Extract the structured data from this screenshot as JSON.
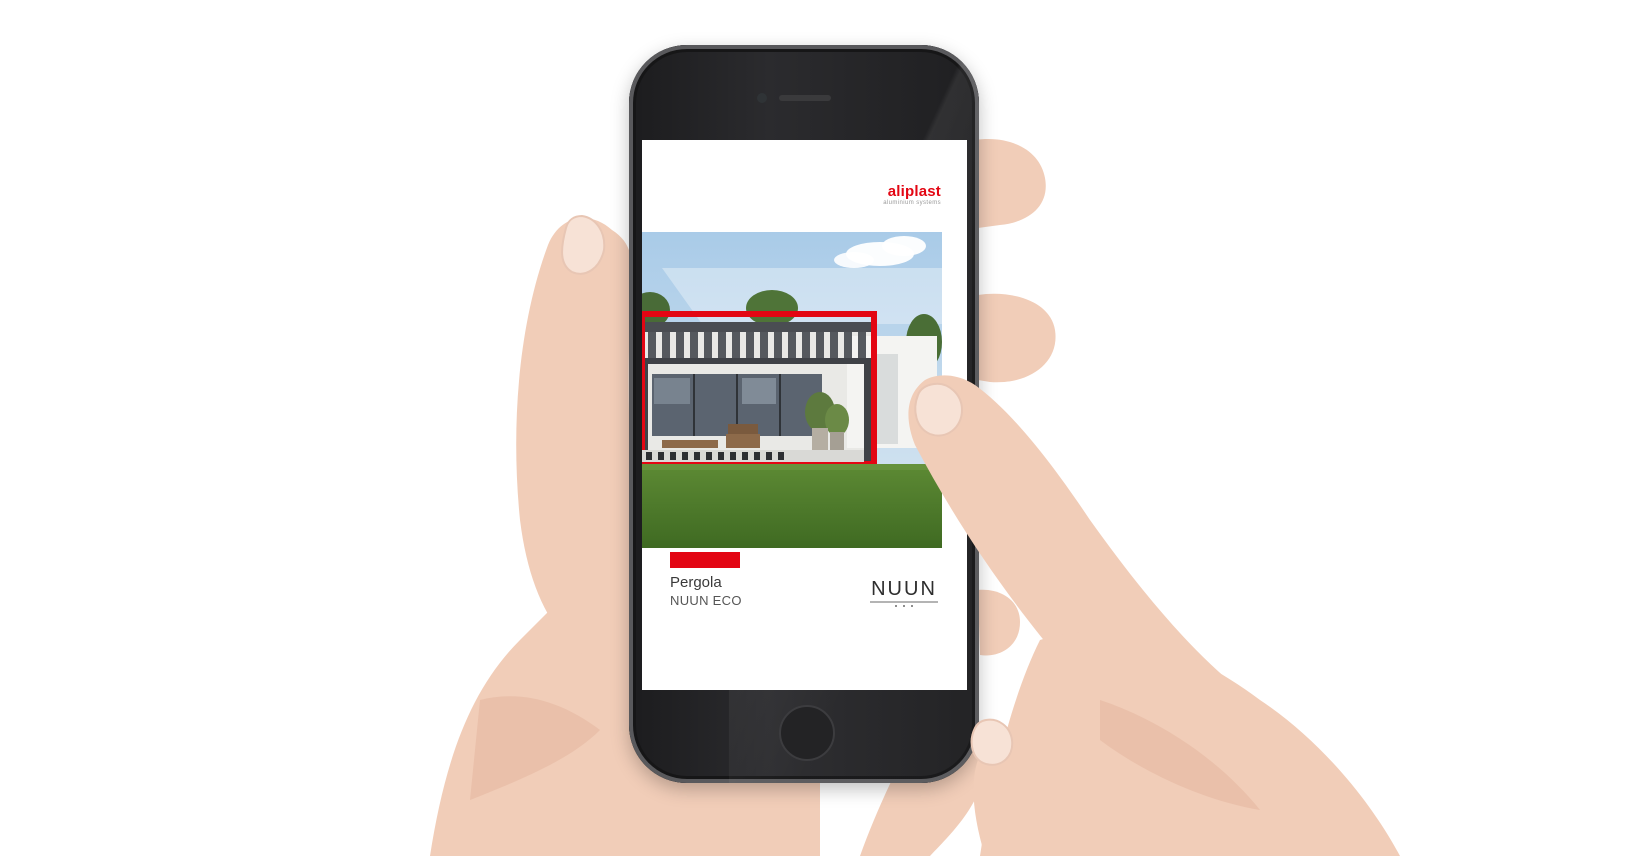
{
  "cover": {
    "brand_name": "aliplast",
    "brand_tagline": "aluminium systems",
    "product_title": "Pergola",
    "product_subtitle": "NUUN ECO",
    "logo_text": "NUUN"
  },
  "icons": {
    "nuun_logo": "nuun-logo-icon",
    "home_button": "home-button-icon"
  },
  "colors": {
    "brand_red": "#e30613",
    "phone_body": "#1f1f21",
    "grass": "#4f7a2c",
    "sky": "#b9d6ef"
  }
}
